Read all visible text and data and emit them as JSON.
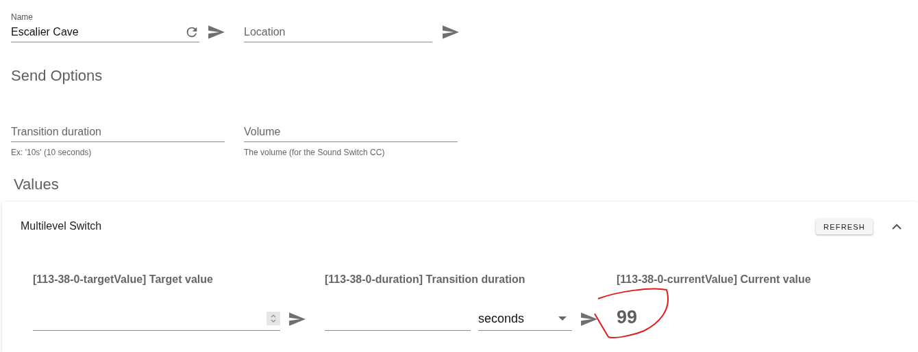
{
  "node_fields": [
    {
      "label": "Name",
      "value": "Escalier Cave",
      "kind": "refreshable"
    },
    {
      "placeholder": "Location",
      "kind": "plain"
    }
  ],
  "send_options": {
    "title": "Send Options",
    "fields": [
      {
        "placeholder": "Transition duration",
        "hint": "Ex: '10s' (10 seconds)"
      },
      {
        "placeholder": "Volume",
        "hint": "The volume (for the Sound Switch CC)"
      }
    ]
  },
  "values_section": {
    "title": "Values",
    "groups": [
      {
        "title": "Multilevel Switch",
        "expanded": true,
        "refresh_button": "REFRESH",
        "values": [
          {
            "kind": "number",
            "label": "[113-38-0-targetValue] Target value"
          },
          {
            "kind": "duration",
            "label": "[113-38-0-duration] Transition duration",
            "unit": "seconds"
          },
          {
            "kind": "readonly",
            "label": "[113-38-0-currentValue] Current value",
            "value": "99"
          }
        ]
      }
    ]
  }
}
